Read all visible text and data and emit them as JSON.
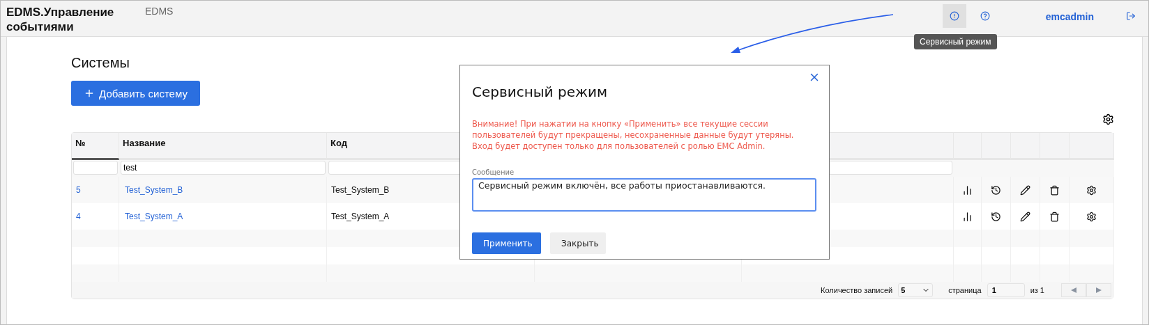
{
  "header": {
    "app_title": "EDMS.Управление событиями",
    "section": "EDMS",
    "service_mode_active": true,
    "user": "emcadmin",
    "tooltip": "Сервисный режим"
  },
  "page": {
    "title": "Системы",
    "add_button": "Добавить систему"
  },
  "table": {
    "columns": [
      {
        "label": "№",
        "sorted": true
      },
      {
        "label": "Название",
        "sorted": false,
        "filter": "test"
      },
      {
        "label": "Код",
        "sorted": false
      }
    ],
    "rows": [
      {
        "id": "5",
        "name": "Test_System_B",
        "code": "Test_System_B"
      },
      {
        "id": "4",
        "name": "Test_System_A",
        "code": "Test_System_A"
      }
    ],
    "pagination": {
      "count_label": "Количество записей",
      "page_size": "5",
      "page_label": "страница",
      "page": "1",
      "of": "из 1"
    }
  },
  "dialog": {
    "title": "Сервисный режим",
    "warning": "Внимание! При нажатии на кнопку «Применить» все текущие сессии пользователей будут прекращены, несохраненные данные будут утеряны. Вход будет доступен только для пользователей с ролью EMC Admin.",
    "field_label": "Сообщение",
    "message": "Сервисный режим включён, все работы приостанавливаются.",
    "apply": "Применить",
    "close": "Закрыть"
  }
}
